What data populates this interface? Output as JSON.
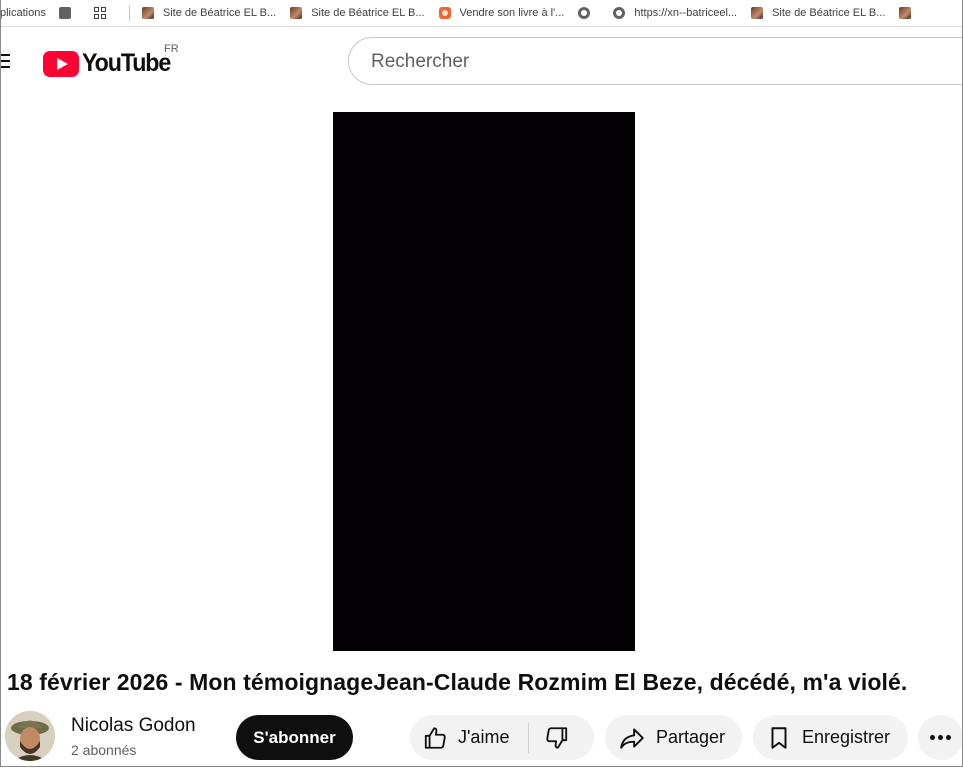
{
  "bookmarks_bar": {
    "items": [
      {
        "label": "plications",
        "icon": "none"
      },
      {
        "label": "",
        "icon": "gray-square-icon"
      },
      {
        "label": "",
        "icon": "apps-grid-icon"
      },
      {
        "label": "Site de Béatrice EL B...",
        "icon": "photo-favicon-icon"
      },
      {
        "label": "Site de Béatrice EL B...",
        "icon": "photo-favicon-icon"
      },
      {
        "label": "Vendre son livre à l'...",
        "icon": "orange-favicon-icon"
      },
      {
        "label": "",
        "icon": "globe-icon"
      },
      {
        "label": "https://xn--batriceel...",
        "icon": "globe-icon"
      },
      {
        "label": "Site de Béatrice EL B...",
        "icon": "photo-favicon-icon"
      },
      {
        "label": "",
        "icon": "photo-favicon-icon"
      }
    ]
  },
  "masthead": {
    "logo_text": "YouTube",
    "region": "FR",
    "search_placeholder": "Rechercher",
    "brand_color": "#ff0033"
  },
  "video": {
    "title": "18 février 2026 - Mon témoignageJean-Claude Rozmim El Beze, décédé, m'a violé.",
    "player_color": "#030104"
  },
  "owner": {
    "channel_name": "Nicolas Godon",
    "subscriber_count": "2 abonnés",
    "subscribe_label": "S'abonner"
  },
  "actions": {
    "like_label": "J'aime",
    "share_label": "Partager",
    "save_label": "Enregistrer"
  }
}
